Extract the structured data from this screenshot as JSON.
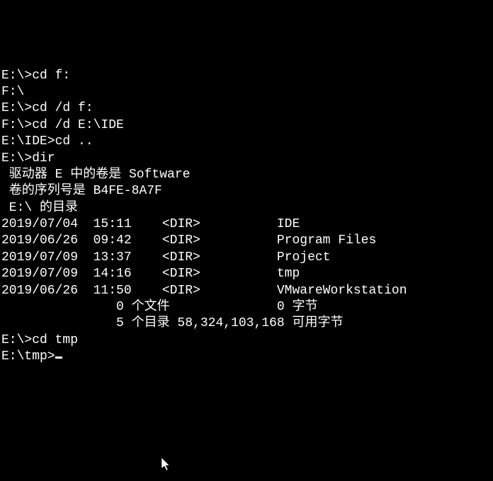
{
  "lines": {
    "l0": "E:\\>cd f:",
    "l1": "F:\\",
    "l2": "",
    "l3": "E:\\>cd /d f:",
    "l4": "",
    "l5": "F:\\>cd /d E:\\IDE",
    "l6": "",
    "l7": "E:\\IDE>cd ..",
    "l8": "",
    "l9": "E:\\>dir",
    "l10": " 驱动器 E 中的卷是 Software",
    "l11": " 卷的序列号是 B4FE-8A7F",
    "l12": "",
    "l13": " E:\\ 的目录",
    "l14": "",
    "l15": "2019/07/04  15:11    <DIR>          IDE",
    "l16": "2019/06/26  09:42    <DIR>          Program Files",
    "l17": "2019/07/09  13:37    <DIR>          Project",
    "l18": "2019/07/09  14:16    <DIR>          tmp",
    "l19": "2019/06/26  11:50    <DIR>          VMwareWorkstation",
    "l20": "               0 个文件              0 字节",
    "l21": "               5 个目录 58,324,103,168 可用字节",
    "l22": "",
    "l23": "E:\\>cd tmp",
    "l24": "",
    "l25": "E:\\tmp>"
  }
}
